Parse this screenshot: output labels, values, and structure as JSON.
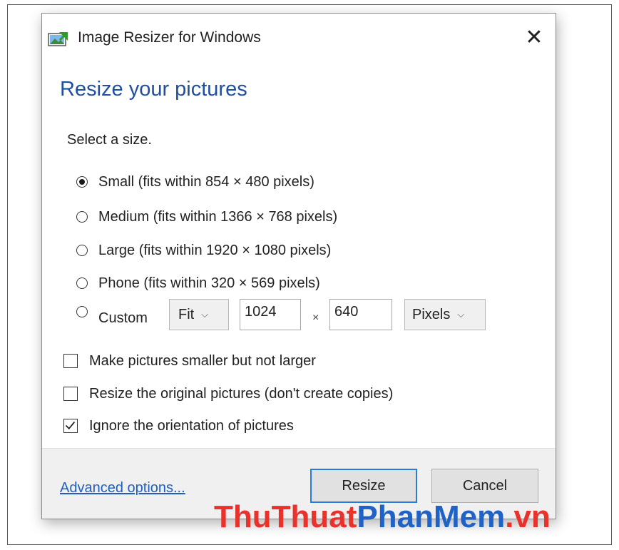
{
  "window": {
    "title": "Image Resizer for Windows",
    "close_glyph": "✕",
    "app_icon": "image-resizer-icon"
  },
  "heading": "Resize your pictures",
  "select_label": "Select a size.",
  "sizes": [
    {
      "label": "Small (fits within 854 × 480 pixels)",
      "selected": true
    },
    {
      "label": "Medium (fits within 1366 × 768 pixels)",
      "selected": false
    },
    {
      "label": "Large (fits within 1920 × 1080 pixels)",
      "selected": false
    },
    {
      "label": "Phone (fits within 320 × 569 pixels)",
      "selected": false
    },
    {
      "label": "Custom",
      "selected": false
    }
  ],
  "custom": {
    "fit_mode": "Fit",
    "width": "1024",
    "times": "×",
    "height": "640",
    "unit": "Pixels"
  },
  "options": [
    {
      "label": "Make pictures smaller but not larger",
      "checked": false
    },
    {
      "label": "Resize the original pictures (don't create copies)",
      "checked": false
    },
    {
      "label": "Ignore the orientation of pictures",
      "checked": true
    }
  ],
  "footer": {
    "advanced_link": "Advanced options...",
    "resize_label": "Resize",
    "cancel_label": "Cancel"
  },
  "watermark": {
    "part1": "ThuThuat",
    "part2": "PhanMem",
    "part3": ".vn"
  },
  "colors": {
    "heading": "#1f4fa3",
    "link": "#1f5fc2",
    "default_button_border": "#2a7bd6",
    "footer_bg": "#f0f0f0",
    "watermark_red": "#e8322b",
    "watermark_blue": "#1f63c6"
  }
}
